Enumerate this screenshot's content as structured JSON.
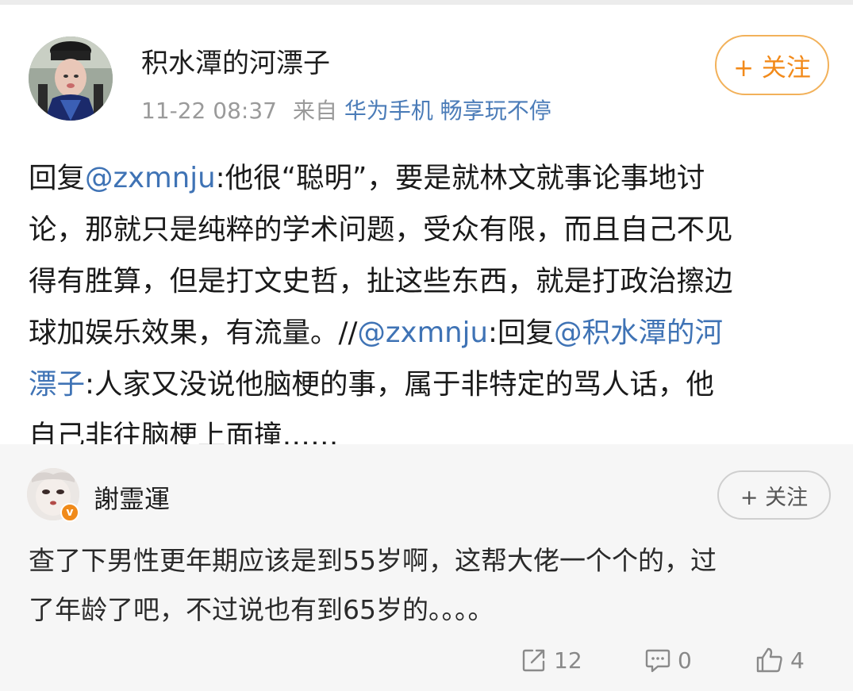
{
  "post": {
    "username": "积水潭的河漂子",
    "time": "11-22 08:37",
    "source_prefix": "来自",
    "device": "华为手机 畅享玩不停",
    "follow_label": "+ 关注",
    "body": {
      "l1_a": "回复",
      "l1_mention": "@zxmnju",
      "l1_b": ":他很“聪明”，要是就林文就事论事地讨",
      "l2": "论，那就只是纯粹的学术问题，受众有限，而且自己不见",
      "l3": "得有胜算，但是打文史哲，扯这些东西，就是打政治擦边",
      "l4_a": "球加娱乐效果，有流量。//",
      "l4_mention1": "@zxmnju",
      "l4_b": ":回复",
      "l4_mention2": "@积水潭的河",
      "l5_mention": "漂子",
      "l5_b": ":人家又没说他脑梗的事，属于非特定的骂人话，他",
      "l6": "自己非往脑梗上面撞……"
    }
  },
  "repost": {
    "username": "謝霊運",
    "verified_icon": "v",
    "follow_label": "+ 关注",
    "body": {
      "l1": "查了下男性更年期应该是到55岁啊，这帮大佬一个个的，过",
      "l2": "了年龄了吧，不过说也有到65岁的。。。。"
    },
    "actions": {
      "share_count": "12",
      "comment_count": "0",
      "like_count": "4"
    }
  },
  "colors": {
    "link": "#3f73b5",
    "follow_accent": "#f28a1a",
    "meta_gray": "#9a9a9a",
    "repost_bg": "#f6f6f6"
  },
  "icons": [
    "share-icon",
    "comment-icon",
    "like-icon",
    "verified-badge-icon"
  ]
}
